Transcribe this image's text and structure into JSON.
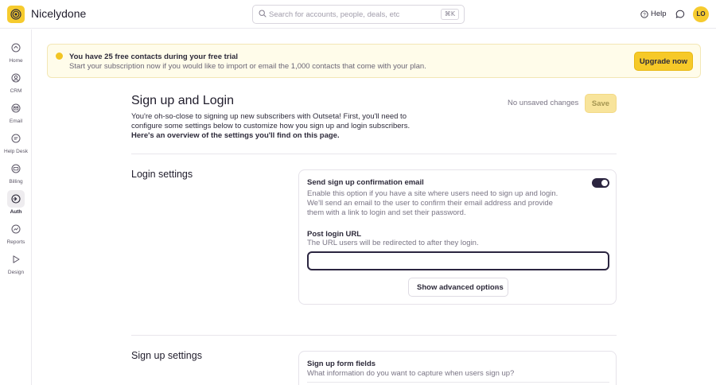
{
  "app": {
    "brand": "Nicelydone",
    "search_placeholder": "Search for accounts, people, deals, etc",
    "search_shortcut": "⌘K",
    "help_label": "Help",
    "avatar_initials": "LO"
  },
  "sidebar": {
    "items": [
      {
        "label": "Home",
        "icon": "home-icon"
      },
      {
        "label": "CRM",
        "icon": "crm-icon"
      },
      {
        "label": "Email",
        "icon": "email-icon"
      },
      {
        "label": "Help Desk",
        "icon": "help-desk-icon"
      },
      {
        "label": "Billing",
        "icon": "billing-icon"
      },
      {
        "label": "Auth",
        "icon": "auth-icon",
        "active": true
      },
      {
        "label": "Reports",
        "icon": "reports-icon"
      },
      {
        "label": "Design",
        "icon": "design-icon"
      }
    ]
  },
  "banner": {
    "title": "You have 25 free contacts during your free trial",
    "message": "Start your subscription now if you would like to import or email the 1,000 contacts that come with your plan.",
    "upgrade_label": "Upgrade now"
  },
  "page": {
    "title": "Sign up and Login",
    "status": "No unsaved changes",
    "save_label": "Save",
    "intro_plain": "You're oh-so-close to signing up new subscribers with Outseta! First, you'll need to configure some settings below to customize how you sign up and login subscribers.",
    "intro_bold": " Here's an overview of the settings you'll find on this page."
  },
  "login_settings": {
    "title": "Login settings",
    "confirm_email": {
      "title": "Send sign up confirmation email",
      "description": "Enable this option if you have a site where users need to sign up and login. We'll send an email to the user to confirm their email address and provide them with a link to login and set their password.",
      "enabled": true
    },
    "post_login_url": {
      "title": "Post login URL",
      "description": "The URL users will be redirected to after they login.",
      "value": ""
    },
    "advanced_label": "Show advanced options"
  },
  "signup_settings": {
    "title": "Sign up settings",
    "form_fields": {
      "title": "Sign up form fields",
      "description": "What information do you want to capture when users sign up?"
    }
  },
  "colors": {
    "accent": "#f6cb2e",
    "dark": "#2b2540",
    "banner_bg": "#fffcea"
  }
}
